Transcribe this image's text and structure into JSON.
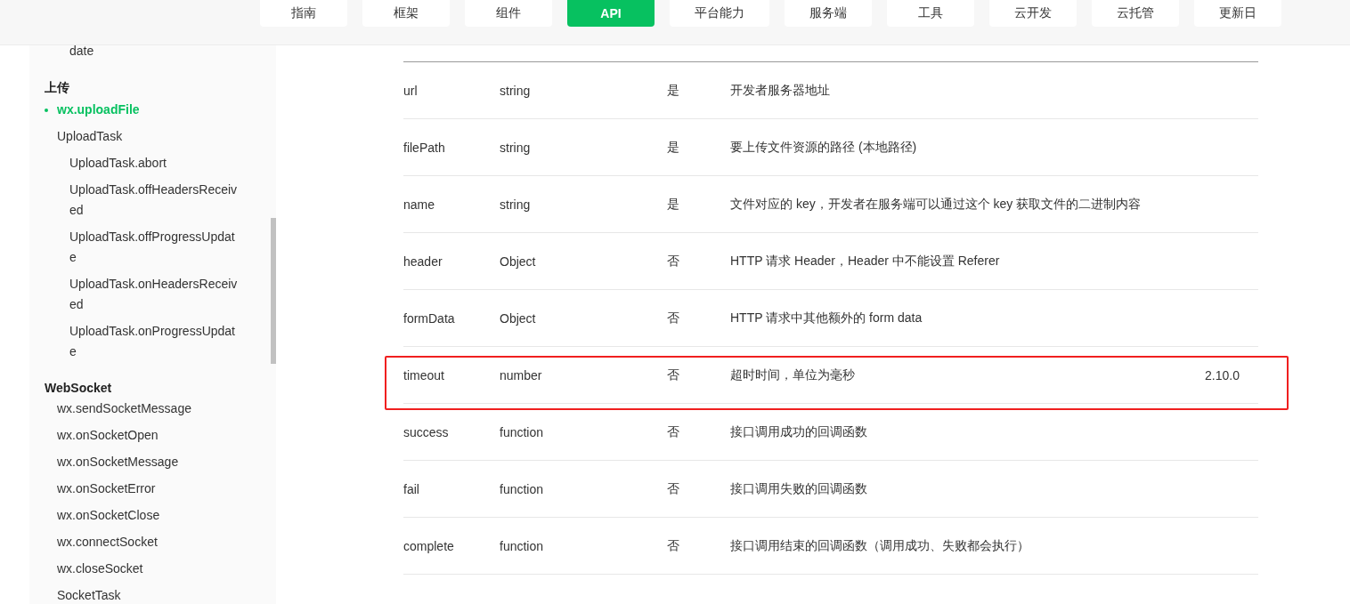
{
  "top_nav": {
    "tabs": [
      {
        "label": "指南",
        "selected": false
      },
      {
        "label": "框架",
        "selected": false
      },
      {
        "label": "组件",
        "selected": false
      },
      {
        "label": "API",
        "selected": true
      },
      {
        "label": "平台能力",
        "selected": false
      },
      {
        "label": "服务端",
        "selected": false
      },
      {
        "label": "工具",
        "selected": false
      },
      {
        "label": "云开发",
        "selected": false
      },
      {
        "label": "云托管",
        "selected": false
      },
      {
        "label": "更新日",
        "selected": false
      }
    ]
  },
  "sidebar": {
    "sections": [
      {
        "items": [
          {
            "label": "date",
            "kind": "fragment",
            "selected": false
          }
        ]
      },
      {
        "title": "上传",
        "items": [
          {
            "label": "wx.uploadFile",
            "kind": "link",
            "selected": true
          },
          {
            "label": "UploadTask",
            "kind": "link",
            "selected": false,
            "children": [
              {
                "label": "UploadTask.abort",
                "kind": "link",
                "selected": false
              },
              {
                "label": "UploadTask.offHeadersReceived",
                "kind": "link",
                "selected": false
              },
              {
                "label": "UploadTask.offProgressUpdate",
                "kind": "link",
                "selected": false
              },
              {
                "label": "UploadTask.onHeadersReceived",
                "kind": "link",
                "selected": false
              },
              {
                "label": "UploadTask.onProgressUpdate",
                "kind": "link",
                "selected": false
              }
            ]
          }
        ]
      },
      {
        "title": "WebSocket",
        "items": [
          {
            "label": "wx.sendSocketMessage",
            "kind": "link",
            "selected": false
          },
          {
            "label": "wx.onSocketOpen",
            "kind": "link",
            "selected": false
          },
          {
            "label": "wx.onSocketMessage",
            "kind": "link",
            "selected": false
          },
          {
            "label": "wx.onSocketError",
            "kind": "link",
            "selected": false
          },
          {
            "label": "wx.onSocketClose",
            "kind": "link",
            "selected": false
          },
          {
            "label": "wx.connectSocket",
            "kind": "link",
            "selected": false
          },
          {
            "label": "wx.closeSocket",
            "kind": "link",
            "selected": false
          },
          {
            "label": "SocketTask",
            "kind": "link",
            "selected": false
          }
        ]
      }
    ]
  },
  "table": {
    "rows": [
      {
        "name": "url",
        "type": "string",
        "required": "是",
        "description": "开发者服务器地址",
        "highlighted": false
      },
      {
        "name": "filePath",
        "type": "string",
        "required": "是",
        "description": "要上传文件资源的路径 (本地路径)",
        "highlighted": false
      },
      {
        "name": "name",
        "type": "string",
        "required": "是",
        "description": "文件对应的 key，开发者在服务端可以通过这个 key 获取文件的二进制内容",
        "highlighted": false
      },
      {
        "name": "header",
        "type": "Object",
        "required": "否",
        "description": "HTTP 请求 Header，Header 中不能设置 Referer",
        "highlighted": false
      },
      {
        "name": "formData",
        "type": "Object",
        "required": "否",
        "description": "HTTP 请求中其他额外的 form data",
        "highlighted": false
      },
      {
        "name": "timeout",
        "type": "number",
        "required": "否",
        "description": "超时时间，单位为毫秒",
        "version": "2.10.0",
        "highlighted": true
      },
      {
        "name": "success",
        "type": "function",
        "required": "否",
        "description": "接口调用成功的回调函数",
        "highlighted": false
      },
      {
        "name": "fail",
        "type": "function",
        "required": "否",
        "description": "接口调用失败的回调函数",
        "highlighted": false
      },
      {
        "name": "complete",
        "type": "function",
        "required": "否",
        "description": "接口调用结束的回调函数（调用成功、失败都会执行）",
        "highlighted": false
      }
    ]
  }
}
